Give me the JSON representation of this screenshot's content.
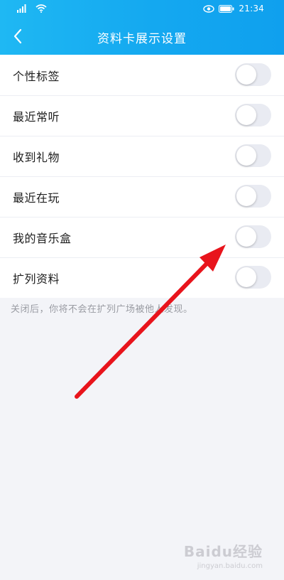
{
  "status_bar": {
    "time": "21:34",
    "icons": [
      "signal-icon",
      "wifi-icon",
      "eye-icon",
      "battery-icon"
    ]
  },
  "header": {
    "title": "资料卡展示设置",
    "back_icon": "chevron-left-icon",
    "gradient_start": "#1fb8f3",
    "gradient_end": "#0fa0ee"
  },
  "settings": {
    "items": [
      {
        "label": "个性标签",
        "enabled": false
      },
      {
        "label": "最近常听",
        "enabled": false
      },
      {
        "label": "收到礼物",
        "enabled": false
      },
      {
        "label": "最近在玩",
        "enabled": false
      },
      {
        "label": "我的音乐盒",
        "enabled": false
      },
      {
        "label": "扩列资料",
        "enabled": false
      }
    ],
    "hint": "关闭后，你将不会在扩列广场被他人发现。"
  },
  "annotation": {
    "arrow_color": "#e8141c"
  },
  "watermark": {
    "text": "Baidu经验",
    "subtext": "jingyan.baidu.com"
  }
}
